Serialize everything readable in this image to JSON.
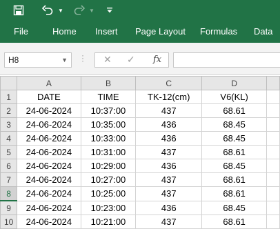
{
  "toolbar": {
    "save_icon": "save-icon",
    "undo_icon": "undo-icon",
    "redo_icon": "redo-icon",
    "customize_icon": "customize-qat-icon"
  },
  "ribbon": {
    "tabs": [
      {
        "label": "File"
      },
      {
        "label": "Home"
      },
      {
        "label": "Insert"
      },
      {
        "label": "Page Layout"
      },
      {
        "label": "Formulas"
      },
      {
        "label": "Data"
      }
    ]
  },
  "formula_bar": {
    "name_box": "H8",
    "cancel": "✕",
    "enter": "✓",
    "fx": "fx",
    "value": ""
  },
  "grid": {
    "columns": [
      "A",
      "B",
      "C",
      "D"
    ],
    "selected_row": "8",
    "rows": [
      {
        "num": "1",
        "cells": [
          "DATE",
          "TIME",
          "TK-12(cm)",
          "V6(KL)"
        ]
      },
      {
        "num": "2",
        "cells": [
          "24-06-2024",
          "10:37:00",
          "437",
          "68.61"
        ]
      },
      {
        "num": "3",
        "cells": [
          "24-06-2024",
          "10:35:00",
          "436",
          "68.45"
        ]
      },
      {
        "num": "4",
        "cells": [
          "24-06-2024",
          "10:33:00",
          "436",
          "68.45"
        ]
      },
      {
        "num": "5",
        "cells": [
          "24-06-2024",
          "10:31:00",
          "437",
          "68.61"
        ]
      },
      {
        "num": "6",
        "cells": [
          "24-06-2024",
          "10:29:00",
          "436",
          "68.45"
        ]
      },
      {
        "num": "7",
        "cells": [
          "24-06-2024",
          "10:27:00",
          "437",
          "68.61"
        ]
      },
      {
        "num": "8",
        "cells": [
          "24-06-2024",
          "10:25:00",
          "437",
          "68.61"
        ]
      },
      {
        "num": "9",
        "cells": [
          "24-06-2024",
          "10:23:00",
          "436",
          "68.45"
        ]
      },
      {
        "num": "10",
        "cells": [
          "24-06-2024",
          "10:21:00",
          "437",
          "68.61"
        ]
      }
    ]
  }
}
